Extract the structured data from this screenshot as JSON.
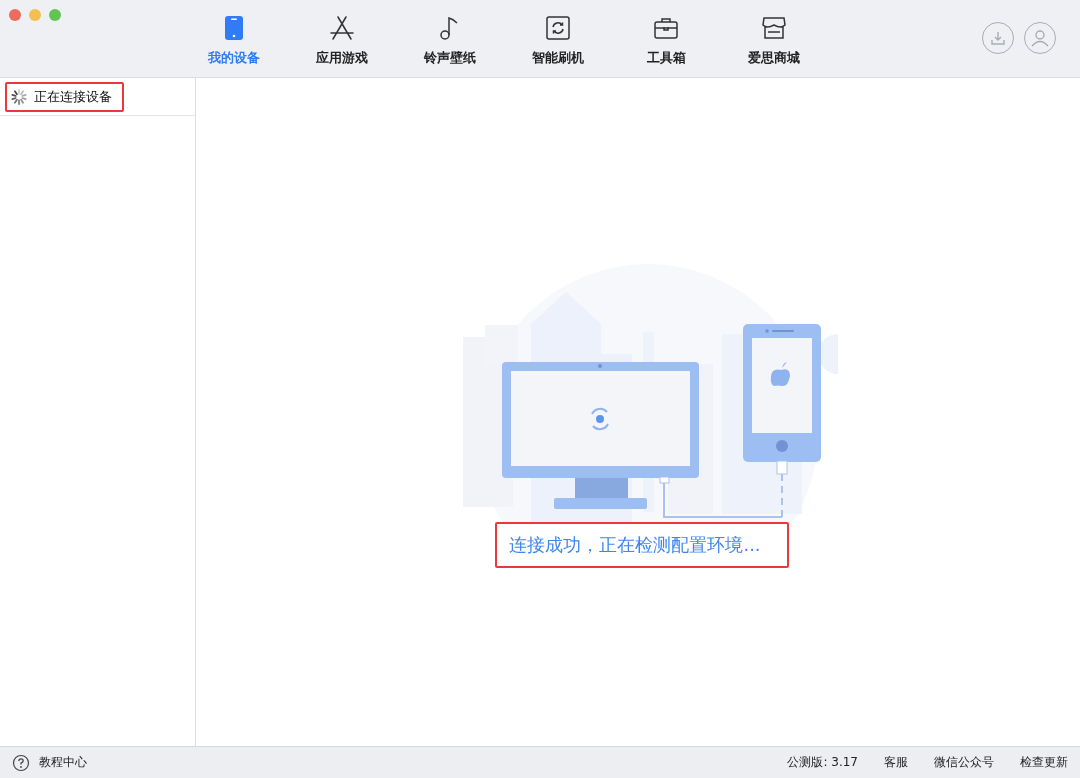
{
  "tabs": [
    {
      "label": "我的设备",
      "selected": true
    },
    {
      "label": "应用游戏",
      "selected": false
    },
    {
      "label": "铃声壁纸",
      "selected": false
    },
    {
      "label": "智能刷机",
      "selected": false
    },
    {
      "label": "工具箱",
      "selected": false
    },
    {
      "label": "爱思商城",
      "selected": false
    }
  ],
  "sidebar": {
    "items": [
      {
        "label": "正在连接设备",
        "kind": "loading"
      }
    ]
  },
  "main": {
    "status_message": "连接成功，正在检测配置环境..."
  },
  "status_bar": {
    "help": "教程中心",
    "version": "公测版: 3.17",
    "links": [
      "客服",
      "微信公众号",
      "检查更新"
    ]
  }
}
